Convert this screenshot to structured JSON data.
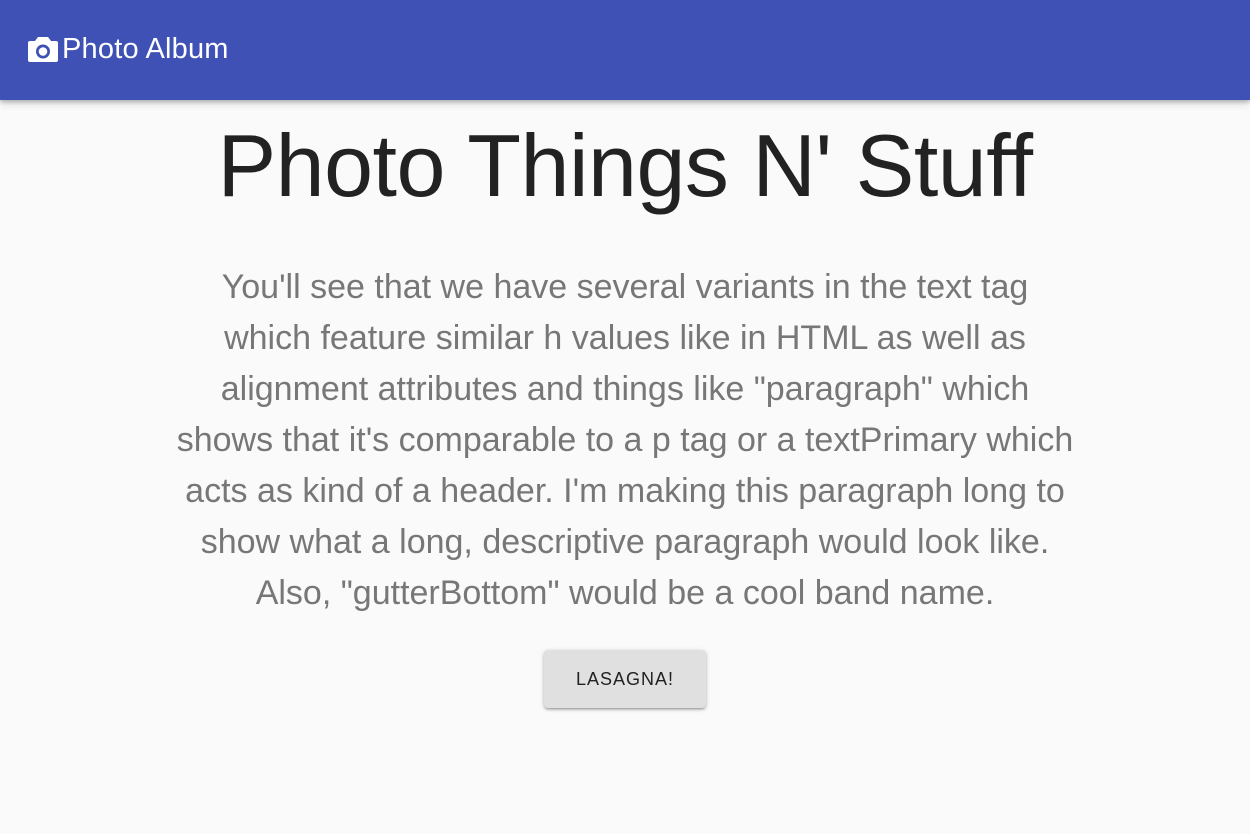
{
  "app_bar": {
    "icon": "camera-icon",
    "title": "Photo Album",
    "color": "#3f51b5"
  },
  "main": {
    "title": "Photo Things N' Stuff",
    "description": "You'll see that we have several variants in the text tag which feature similar h values like in HTML as well as alignment attributes and things like \"paragraph\" which shows that it's comparable to a p tag or a textPrimary which acts as kind of a header. I'm making this paragraph long to show what a long, descriptive paragraph would look like. Also, \"gutterBottom\" would be a cool band name.",
    "button_label": "LASAGNA!"
  }
}
